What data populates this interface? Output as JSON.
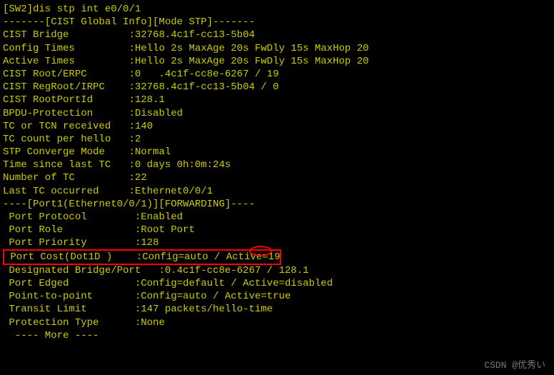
{
  "command": "[SW2]dis stp int e0/0/1",
  "global_header": "-------[CIST Global Info][Mode STP]-------",
  "global": {
    "cist_bridge_label": "CIST Bridge          ",
    "cist_bridge_value": ":32768.4c1f-cc13-5b04",
    "config_times_label": "Config Times         ",
    "config_times_value": ":Hello 2s MaxAge 20s FwDly 15s MaxHop 20",
    "active_times_label": "Active Times         ",
    "active_times_value": ":Hello 2s MaxAge 20s FwDly 15s MaxHop 20",
    "root_erpc_label": "CIST Root/ERPC       ",
    "root_erpc_value": ":0   .4c1f-cc8e-6267 / 19",
    "regroot_irpc_label": "CIST RegRoot/IRPC    ",
    "regroot_irpc_value": ":32768.4c1f-cc13-5b04 / 0",
    "rootportid_label": "CIST RootPortId      ",
    "rootportid_value": ":128.1",
    "bpdu_label": "BPDU-Protection      ",
    "bpdu_value": ":Disabled",
    "tc_recv_label": "TC or TCN received   ",
    "tc_recv_value": ":140",
    "tc_count_label": "TC count per hello   ",
    "tc_count_value": ":2",
    "converge_label": "STP Converge Mode    ",
    "converge_value": ":Normal",
    "time_since_label": "Time since last TC   ",
    "time_since_value": ":0 days 0h:0m:24s",
    "num_tc_label": "Number of TC         ",
    "num_tc_value": ":22",
    "last_tc_label": "Last TC occurred     ",
    "last_tc_value": ":Ethernet0/0/1"
  },
  "port_header": "----[Port1(Ethernet0/0/1)][FORWARDING]----",
  "port": {
    "protocol_label": " Port Protocol        ",
    "protocol_value": ":Enabled",
    "role_label": " Port Role            ",
    "role_value": ":Root Port",
    "priority_label": " Port Priority        ",
    "priority_value": ":128",
    "cost_label": " Port Cost(Dot1D )    ",
    "cost_value": ":Config=auto / Active=19",
    "desig_label": " Designated Bridge/Port   ",
    "desig_value": ":0.4c1f-cc8e-6267 / 128.1",
    "edged_label": " Port Edged           ",
    "edged_value": ":Config=default / Active=disabled",
    "p2p_label": " Point-to-point       ",
    "p2p_value": ":Config=auto / Active=true",
    "transit_label": " Transit Limit        ",
    "transit_value": ":147 packets/hello-time",
    "prot_type_label": " Protection Type      ",
    "prot_type_value": ":None"
  },
  "more_prompt": "  ---- More ----",
  "watermark": "CSDN @优秀い"
}
